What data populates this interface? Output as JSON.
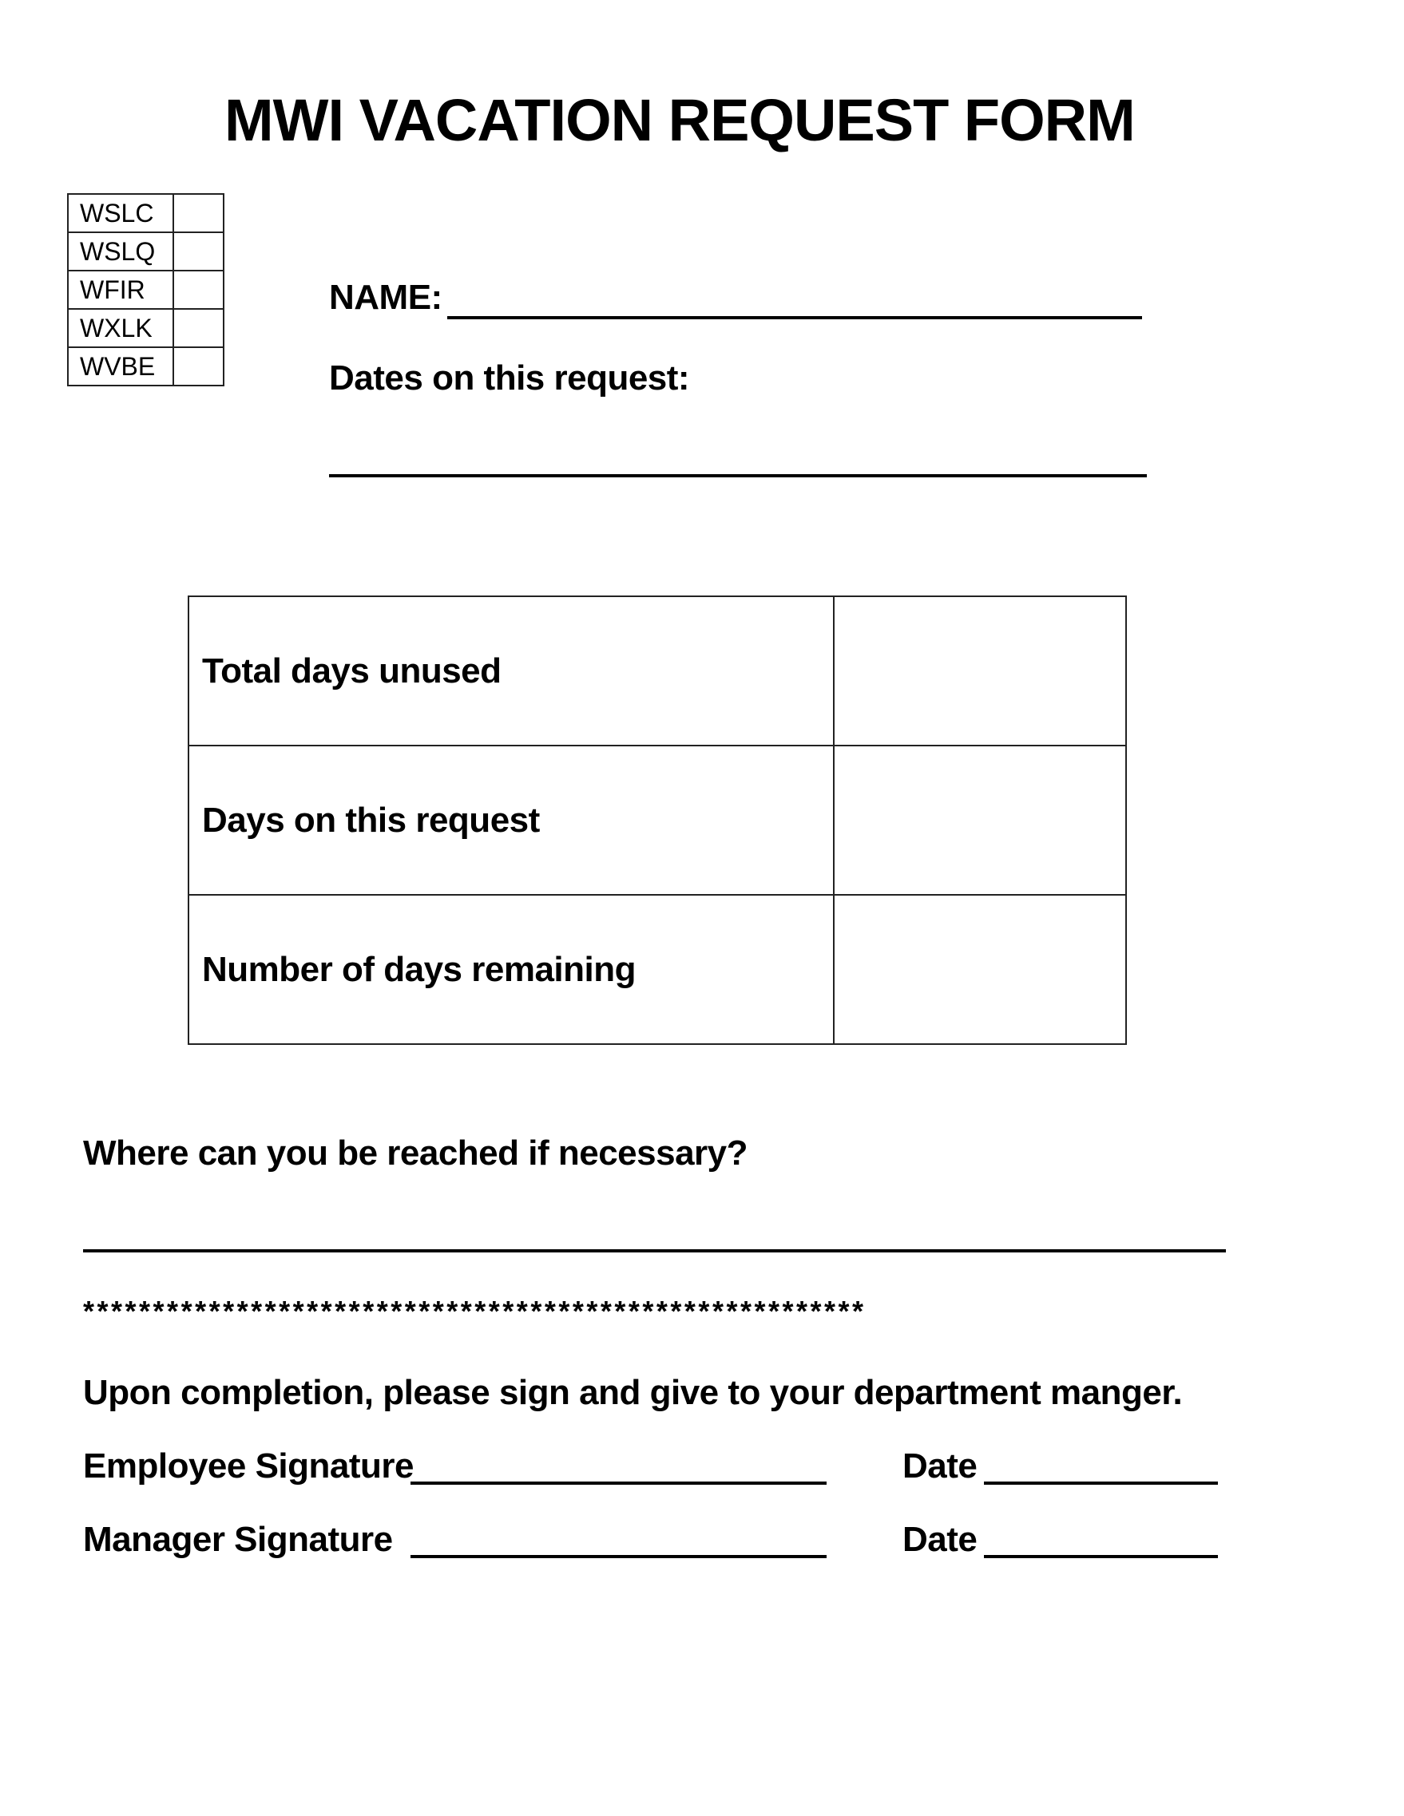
{
  "form": {
    "title": "MWI VACATION REQUEST FORM",
    "locations": [
      {
        "code": "WSLC",
        "checked": false
      },
      {
        "code": "WSLQ",
        "checked": false
      },
      {
        "code": "WFIR",
        "checked": false
      },
      {
        "code": "WXLK",
        "checked": false
      },
      {
        "code": "WVBE",
        "checked": false
      }
    ],
    "name_label": "NAME:",
    "name_value": "",
    "dates_label": "Dates on this request:",
    "dates_value": "",
    "days_table": [
      {
        "label": "Total days unused",
        "value": ""
      },
      {
        "label": "Days on this request",
        "value": ""
      },
      {
        "label": "Number of days remaining",
        "value": ""
      }
    ],
    "contact_question": "Where can you be reached if necessary?",
    "contact_value": "",
    "separator": "********************************************************",
    "instructions": "Upon completion, please sign and give to your department manger.",
    "signatures": [
      {
        "label": "Employee Signature",
        "value": "",
        "date_label": "Date",
        "date_value": ""
      },
      {
        "label": "Manager Signature",
        "value": "",
        "date_label": "Date",
        "date_value": ""
      }
    ]
  }
}
